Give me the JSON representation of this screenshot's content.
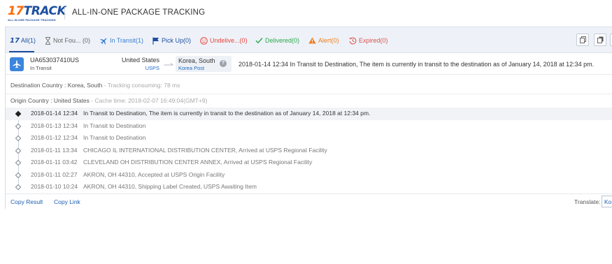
{
  "header": {
    "logo_text_number": "17",
    "logo_text_word": "TRACK",
    "logo_subtext": "ALL-IN-ONE PACKAGE TRACKING",
    "title": "ALL-IN-ONE PACKAGE TRACKING"
  },
  "tabs": [
    {
      "label": "All(1)",
      "icon": "17track-logo-icon",
      "color": "#1e4fa0",
      "active": true
    },
    {
      "label": "Not Fou... (0)",
      "icon": "hourglass-icon",
      "color": "#666666"
    },
    {
      "label": "In Transit(1)",
      "icon": "airplane-icon",
      "color": "#3a7ed6"
    },
    {
      "label": "Pick Up(0)",
      "icon": "flag-icon",
      "color": "#1e4fa0"
    },
    {
      "label": "Undelive...(0)",
      "icon": "sad-face-icon",
      "color": "#e8443a"
    },
    {
      "label": "Delivered(0)",
      "icon": "checkmark-icon",
      "color": "#2aa84a"
    },
    {
      "label": "Alert(0)",
      "icon": "warning-triangle-icon",
      "color": "#ef7e1e"
    },
    {
      "label": "Expired(0)",
      "icon": "clock-expired-icon",
      "color": "#d9534f"
    }
  ],
  "toolbar": {
    "buttons": [
      "copy-icon",
      "copy-all-icon",
      "more-icon"
    ]
  },
  "summary": {
    "tracking_number": "UA653037410US",
    "status": "In Transit",
    "origin_country": "United States",
    "origin_carrier": "USPS",
    "destination_country": "Korea, South",
    "destination_carrier": "Korea Post",
    "latest_event": "2018-01-14 12:34  In Transit to Destination, The item is currently in transit to the destination as of January 14, 2018 at 12:34 pm."
  },
  "details": {
    "destination_label": "Destination Country : Korea, South",
    "destination_sep": " - ",
    "tracking_consuming": "Tracking consuming: 78 ms",
    "origin_label": "Origin Country : United States",
    "origin_sep": " - ",
    "cache_time": "Cache time: 2018-02-07 16:49:04(GMT+9)"
  },
  "events": [
    {
      "time": "2018-01-14 12:34",
      "desc": "In Transit to Destination, The item is currently in transit to the destination as of January 14, 2018 at 12:34 pm."
    },
    {
      "time": "2018-01-13 12:34",
      "desc": "In Transit to Destination"
    },
    {
      "time": "2018-01-12 12:34",
      "desc": "In Transit to Destination"
    },
    {
      "time": "2018-01-11 13:34",
      "desc": "CHICAGO IL INTERNATIONAL DISTRIBUTION CENTER, Arrived at USPS Regional Facility"
    },
    {
      "time": "2018-01-11 03:42",
      "desc": "CLEVELAND OH DISTRIBUTION CENTER ANNEX, Arrived at USPS Regional Facility"
    },
    {
      "time": "2018-01-11 02:27",
      "desc": "AKRON, OH 44310, Accepted at USPS Origin Facility"
    },
    {
      "time": "2018-01-10 10:24",
      "desc": "AKRON, OH 44310, Shipping Label Created, USPS Awaiting Item"
    }
  ],
  "footer": {
    "copy_result": "Copy Result",
    "copy_link": "Copy Link",
    "translate_label": "Translate:",
    "translate_value": "Ko"
  }
}
